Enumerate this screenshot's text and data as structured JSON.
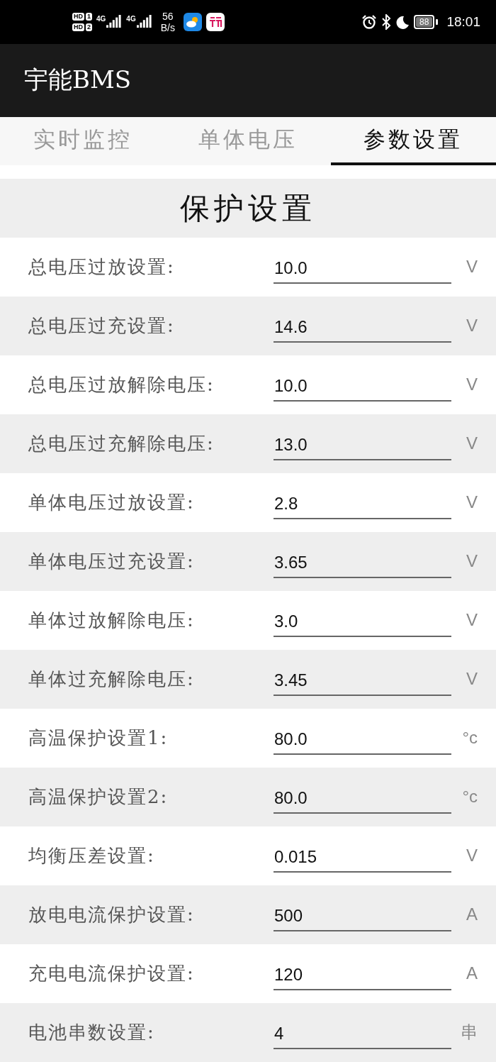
{
  "status_bar": {
    "sims": [
      {
        "badge": "HD",
        "slot": "1"
      },
      {
        "badge": "HD",
        "slot": "2"
      }
    ],
    "networks": [
      "4G",
      "4G"
    ],
    "speed": {
      "value": "56",
      "unit": "B/s"
    },
    "battery": "88",
    "time": "18:01"
  },
  "app_bar": {
    "title": "宇能BMS"
  },
  "tabs": [
    {
      "label": "实时监控",
      "selected": false
    },
    {
      "label": "单体电压",
      "selected": false
    },
    {
      "label": "参数设置",
      "selected": true
    }
  ],
  "section": {
    "title": "保护设置"
  },
  "settings": [
    {
      "label": "总电压过放设置:",
      "value": "10.0",
      "unit": "V"
    },
    {
      "label": "总电压过充设置:",
      "value": "14.6",
      "unit": "V"
    },
    {
      "label": "总电压过放解除电压:",
      "value": "10.0",
      "unit": "V"
    },
    {
      "label": "总电压过充解除电压:",
      "value": "13.0",
      "unit": "V"
    },
    {
      "label": "单体电压过放设置:",
      "value": "2.8",
      "unit": "V"
    },
    {
      "label": "单体电压过充设置:",
      "value": "3.65",
      "unit": "V"
    },
    {
      "label": "单体过放解除电压:",
      "value": "3.0",
      "unit": "V"
    },
    {
      "label": "单体过充解除电压:",
      "value": "3.45",
      "unit": "V"
    },
    {
      "label": "高温保护设置1:",
      "value": "80.0",
      "unit": "°c"
    },
    {
      "label": "高温保护设置2:",
      "value": "80.0",
      "unit": "°c"
    },
    {
      "label": "均衡压差设置:",
      "value": "0.015",
      "unit": "V"
    },
    {
      "label": "放电电流保护设置:",
      "value": "500",
      "unit": "A"
    },
    {
      "label": "充电电流保护设置:",
      "value": "120",
      "unit": "A"
    },
    {
      "label": "电池串数设置:",
      "value": "4",
      "unit": "串"
    }
  ]
}
